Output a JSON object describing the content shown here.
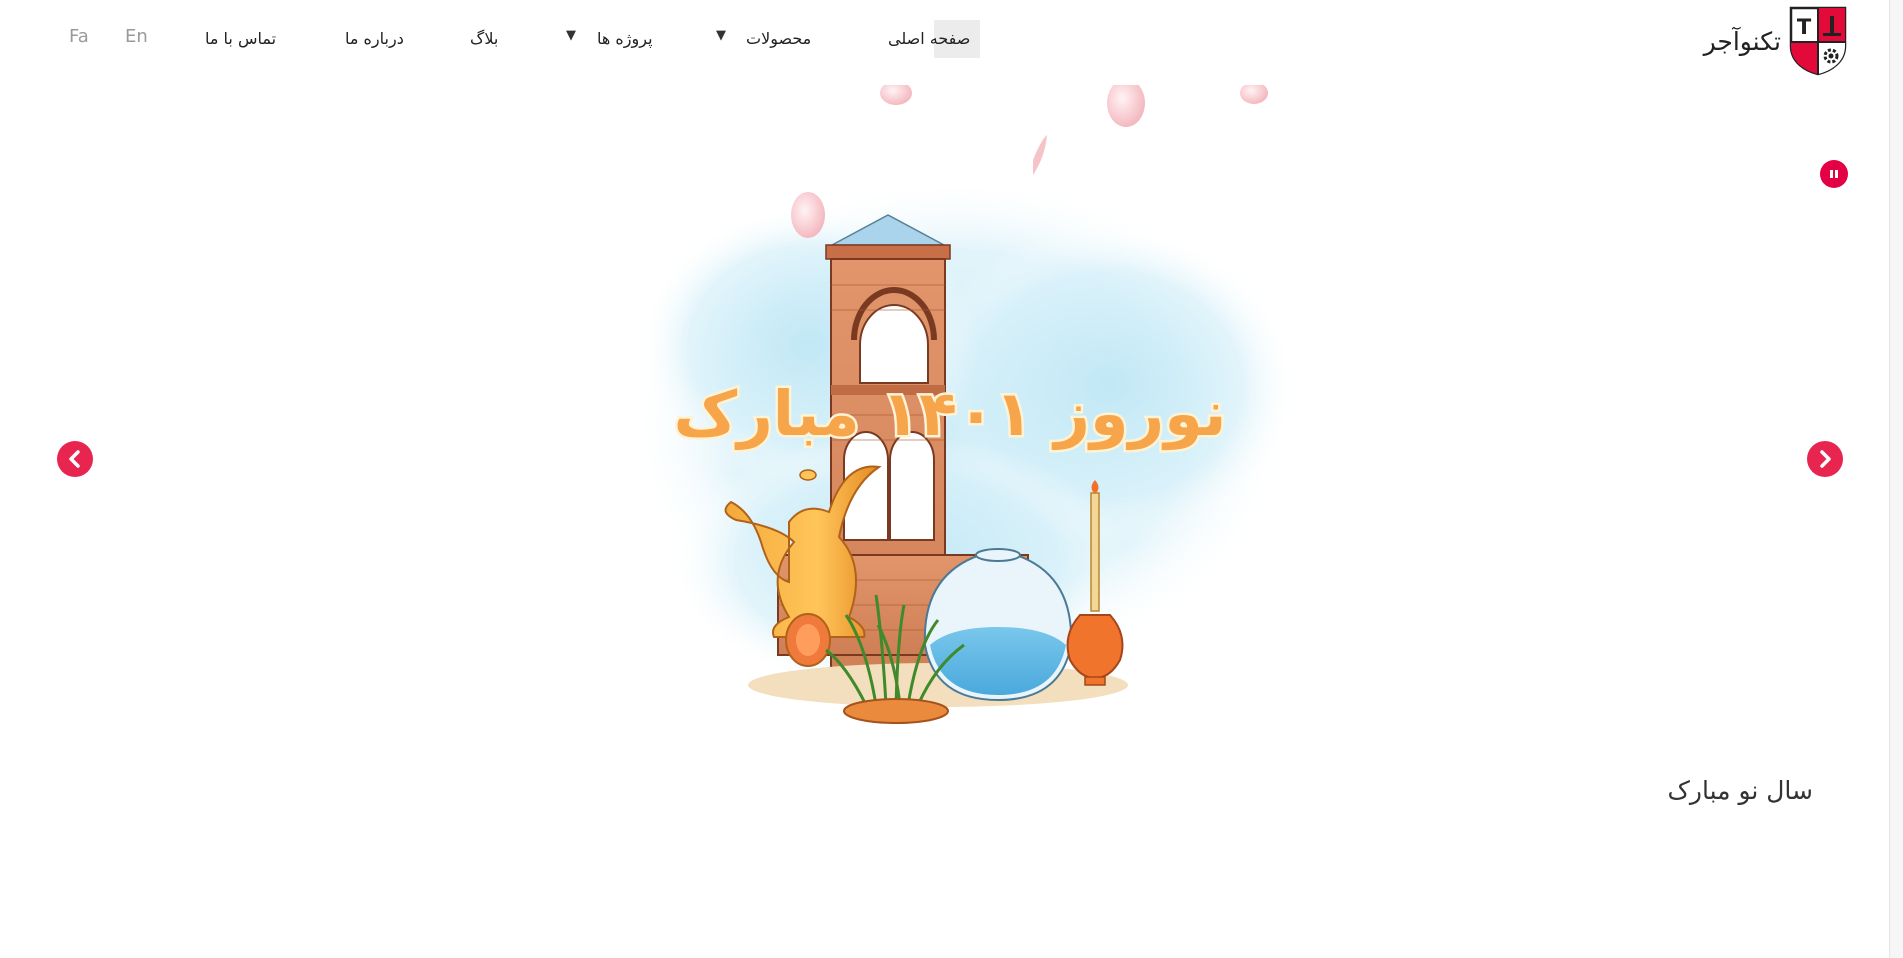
{
  "brand": {
    "name": "تکنوآجر",
    "shield_letter": "T",
    "colors": {
      "red": "#e30a3a",
      "dark": "#222222"
    }
  },
  "nav": {
    "home": "صفحه اصلی",
    "products": "محصولات",
    "projects": "پروژه ها",
    "blog": "بلاگ",
    "about": "درباره ما",
    "contact": "تماس با ما"
  },
  "lang": {
    "en": "En",
    "fa": "Fa"
  },
  "slider": {
    "banner_text": "نوروز ۱۴۰۱ مبارک",
    "caption": "سال نو مبارک",
    "accent": "#e8254f"
  }
}
